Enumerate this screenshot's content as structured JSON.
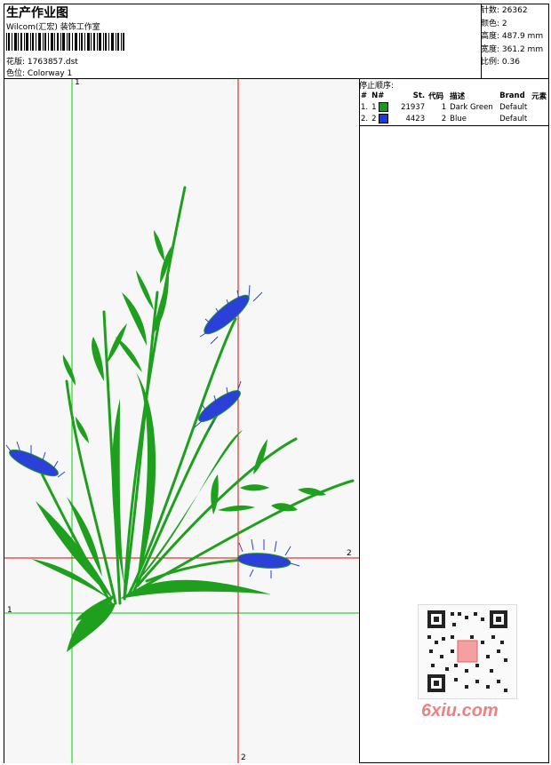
{
  "header": {
    "title": "生产作业图",
    "company": "Wilcom(汇宏) 装饰工作室",
    "design_file_label": "花版:",
    "design_file": "1763857.dst",
    "colorway_label": "色位:",
    "colorway": "Colorway 1"
  },
  "stats": [
    {
      "label": "针数:",
      "value": "26362"
    },
    {
      "label": "颜色:",
      "value": "2"
    },
    {
      "label": "高度:",
      "value": "487.9 mm"
    },
    {
      "label": "宽度:",
      "value": "361.2 mm"
    },
    {
      "label": "比例:",
      "value": "0.36"
    }
  ],
  "stop_sequence": {
    "title": "停止顺序:",
    "headers": [
      "#",
      "N#",
      "St.",
      "代码",
      "描述",
      "Brand",
      "元素"
    ],
    "rows": [
      {
        "index": "1.",
        "n": "1",
        "color": "#1a9a1a",
        "stitches": "21937",
        "code": "1",
        "description": "Dark Green",
        "brand": "Default"
      },
      {
        "index": "2.",
        "n": "2",
        "color": "#1a3ae0",
        "stitches": "4423",
        "code": "2",
        "description": "Blue",
        "brand": "Default"
      }
    ]
  },
  "axes": {
    "green_label_top": "1",
    "green_label_left": "1",
    "red_label_right": "2",
    "red_label_bottom": "2"
  },
  "colors": {
    "green_axis": "#00cc00",
    "red_axis": "#ee0000",
    "stem": "#1ea01e",
    "wheat_head": "#2a40d8"
  },
  "watermark": "6xiu.com"
}
